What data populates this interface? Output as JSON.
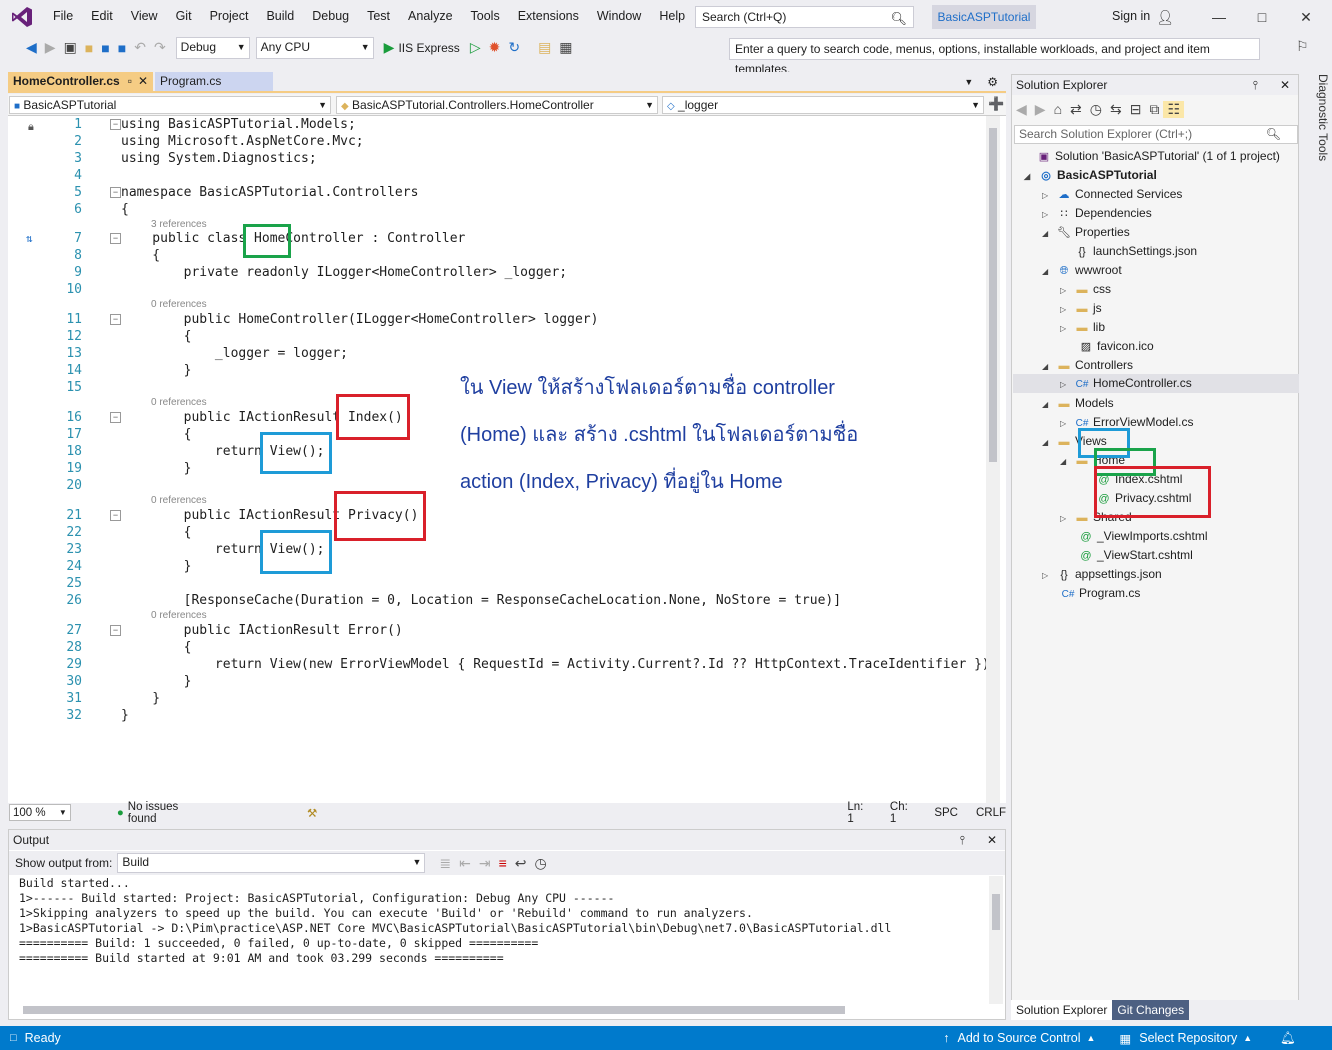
{
  "menu": {
    "items": [
      "File",
      "Edit",
      "View",
      "Git",
      "Project",
      "Build",
      "Debug",
      "Test",
      "Analyze",
      "Tools",
      "Extensions",
      "Window",
      "Help"
    ],
    "search_placeholder": "Search (Ctrl+Q)",
    "solution_name": "BasicASPTutorial",
    "sign_in": "Sign in"
  },
  "toolbar": {
    "config": "Debug",
    "platform": "Any CPU",
    "run_label": "IIS Express",
    "query_placeholder": "Enter a query to search code, menus, options, installable workloads, and project and item templates."
  },
  "editor": {
    "tabs": [
      "HomeController.cs",
      "Program.cs"
    ],
    "nav_project": "BasicASPTutorial",
    "nav_class": "BasicASPTutorial.Controllers.HomeController",
    "nav_member": "_logger",
    "codelens": {
      "l7": "3 references",
      "l11": "0 references",
      "l16": "0 references",
      "l21": "0 references",
      "l27": "0 references"
    },
    "lines": {
      "l1": "using BasicASPTutorial.Models;",
      "l2": "using Microsoft.AspNetCore.Mvc;",
      "l3": "using System.Diagnostics;",
      "l5": "namespace BasicASPTutorial.Controllers",
      "l6": "{",
      "l7": "    public class HomeController : Controller",
      "l8": "    {",
      "l9": "        private readonly ILogger<HomeController> _logger;",
      "l11": "        public HomeController(ILogger<HomeController> logger)",
      "l12": "        {",
      "l13": "            _logger = logger;",
      "l14": "        }",
      "l16": "        public IActionResult Index()",
      "l17": "        {",
      "l18": "            return View();",
      "l19": "        }",
      "l21": "        public IActionResult Privacy()",
      "l22": "        {",
      "l23": "            return View();",
      "l24": "        }",
      "l26": "        [ResponseCache(Duration = 0, Location = ResponseCacheLocation.None, NoStore = true)]",
      "l27": "        public IActionResult Error()",
      "l28": "        {",
      "l29": "            return View(new ErrorViewModel { RequestId = Activity.Current?.Id ?? HttpContext.TraceIdentifier });",
      "l30": "        }",
      "l31": "    }",
      "l32": "}"
    },
    "annotation": [
      "ใน View ให้สร้างโฟลเดอร์ตามชื่อ controller",
      "(Home) และ สร้าง .cshtml ในโฟลเดอร์ตามชื่อ",
      "action (Index, Privacy) ที่อยู่ใน Home"
    ],
    "status": {
      "zoom": "100 %",
      "issues": "No issues found",
      "ln": "Ln: 1",
      "ch": "Ch: 1",
      "spc": "SPC",
      "crlf": "CRLF"
    }
  },
  "solution_explorer": {
    "title": "Solution Explorer",
    "search_placeholder": "Search Solution Explorer (Ctrl+;)",
    "items": [
      "Solution 'BasicASPTutorial' (1 of 1 project)",
      "BasicASPTutorial",
      "Connected Services",
      "Dependencies",
      "Properties",
      "launchSettings.json",
      "wwwroot",
      "css",
      "js",
      "lib",
      "favicon.ico",
      "Controllers",
      "HomeController.cs",
      "Models",
      "ErrorViewModel.cs",
      "Views",
      "Home",
      "Index.cshtml",
      "Privacy.cshtml",
      "Shared",
      "_ViewImports.cshtml",
      "_ViewStart.cshtml",
      "appsettings.json",
      "Program.cs"
    ],
    "tabs": [
      "Solution Explorer",
      "Git Changes"
    ]
  },
  "diagnostic_tools": "Diagnostic Tools",
  "output": {
    "title": "Output",
    "show_from_label": "Show output from:",
    "source": "Build",
    "text": "Build started...\n1>------ Build started: Project: BasicASPTutorial, Configuration: Debug Any CPU ------\n1>Skipping analyzers to speed up the build. You can execute 'Build' or 'Rebuild' command to run analyzers.\n1>BasicASPTutorial -> D:\\Pim\\practice\\ASP.NET Core MVC\\BasicASPTutorial\\BasicASPTutorial\\bin\\Debug\\net7.0\\BasicASPTutorial.dll\n========== Build: 1 succeeded, 0 failed, 0 up-to-date, 0 skipped ==========\n========== Build started at 9:01 AM and took 03.299 seconds =========="
  },
  "statusbar": {
    "ready": "Ready",
    "source_control": "Add to Source Control",
    "repository": "Select Repository"
  },
  "colors": {
    "accent": "#007acc",
    "annotation_green": "#1aa34a",
    "annotation_red": "#d9202a",
    "annotation_blue": "#1e9bd7"
  }
}
